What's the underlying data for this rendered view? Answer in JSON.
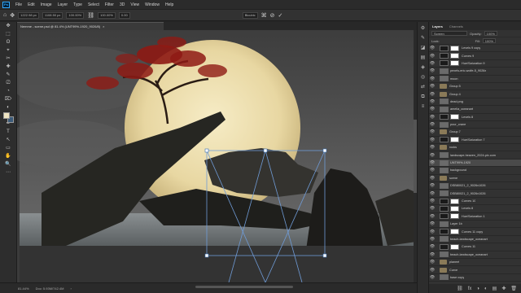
{
  "menubar": {
    "logo": "Ps",
    "items": [
      "File",
      "Edit",
      "Image",
      "Layer",
      "Type",
      "Select",
      "Filter",
      "3D",
      "View",
      "Window",
      "Help"
    ]
  },
  "options_bar": {
    "x_value": "1222.98 px",
    "y_value": "1108.50 px",
    "w_value": "100.00%",
    "h_value": "100.00%",
    "angle_value": "0.00",
    "interp_value": "Bicubic",
    "cancel_glyph": "⊘",
    "commit_glyph": "✓"
  },
  "document_tab": {
    "title": "Nemme - scene.psd @ 81.4% (UNT99%-1920_9026/8)",
    "close": "×"
  },
  "status": {
    "zoom": "81.44%",
    "doc_info": "Doc: 5.93M/742.4M",
    "arrow": "›"
  },
  "toolbar": {
    "tools": [
      "✥",
      "⬚",
      "ʘ",
      "⌖",
      "✂",
      "✚",
      "✎",
      "⎚",
      "◔",
      "⌦",
      "◐",
      "▲",
      "✒",
      "T",
      "↖",
      "▭",
      "✋",
      "🔍",
      "⋯"
    ]
  },
  "icon_strip": [
    "⚙",
    "✎",
    "◪",
    "▤",
    "◈",
    "◎",
    "⇄",
    "⧉",
    "≡"
  ],
  "layers_panel": {
    "tabs": [
      "Layers",
      "Channels"
    ],
    "blend_mode": "Screen",
    "opacity_label": "Opacity:",
    "opacity_value": "100%",
    "lock_label": "Lock:",
    "fill_label": "Fill:",
    "fill_value": "100%",
    "layers": [
      {
        "name": "Levels 9 copy",
        "type": "adjust",
        "selected": false
      },
      {
        "name": "Curves 9",
        "type": "adjust",
        "selected": false
      },
      {
        "name": "Hue/Saturation 9",
        "type": "adjust",
        "selected": false
      },
      {
        "name": "pexels-eric-wolfe-5_9026x",
        "type": "pixel",
        "selected": false
      },
      {
        "name": "moon",
        "type": "pixel",
        "selected": false
      },
      {
        "name": "Group 5",
        "type": "group",
        "selected": false
      },
      {
        "name": "Group 4",
        "type": "group",
        "selected": false
      },
      {
        "name": "dead.png",
        "type": "pixel",
        "selected": false
      },
      {
        "name": "amelia_oceanart",
        "type": "pixel",
        "selected": false
      },
      {
        "name": "Levels 8",
        "type": "adjust",
        "selected": false
      },
      {
        "name": "pour_crane",
        "type": "pixel",
        "selected": false
      },
      {
        "name": "Group 7",
        "type": "group",
        "selected": false
      },
      {
        "name": "Hue/Saturation 7",
        "type": "adjust",
        "selected": false
      },
      {
        "name": "rocks",
        "type": "group",
        "selected": false
      },
      {
        "name": "landscape-heaven_2024-pix.com",
        "type": "pixel",
        "selected": false
      },
      {
        "name": "UNT99%-1920",
        "type": "pixel",
        "selected": true
      },
      {
        "name": "background",
        "type": "pixel",
        "selected": false
      },
      {
        "name": "scene",
        "type": "group",
        "selected": false
      },
      {
        "name": "DSB80021_2_9026x1026",
        "type": "pixel",
        "selected": false
      },
      {
        "name": "DSB80021_2_9026x1026",
        "type": "pixel",
        "selected": false
      },
      {
        "name": "Curves 10",
        "type": "adjust",
        "selected": false
      },
      {
        "name": "Levels 8",
        "type": "adjust",
        "selected": false
      },
      {
        "name": "Hue/Saturation 1",
        "type": "adjust",
        "selected": false
      },
      {
        "name": "Layer 1b",
        "type": "pixel",
        "selected": false
      },
      {
        "name": "Curves 11 copy",
        "type": "adjust",
        "selected": false
      },
      {
        "name": "beach-landscape_oceanart",
        "type": "pixel",
        "selected": false
      },
      {
        "name": "Curves 11",
        "type": "adjust",
        "selected": false
      },
      {
        "name": "beach-landscape_oceanart",
        "type": "pixel",
        "selected": false
      },
      {
        "name": "planeet",
        "type": "group",
        "selected": false
      },
      {
        "name": "Curve",
        "type": "group",
        "selected": false
      },
      {
        "name": "base copy",
        "type": "pixel",
        "selected": false
      }
    ],
    "bottom_icons": [
      "⛓",
      "fx",
      "◑",
      "◐",
      "▤",
      "✚",
      "🗑"
    ]
  }
}
